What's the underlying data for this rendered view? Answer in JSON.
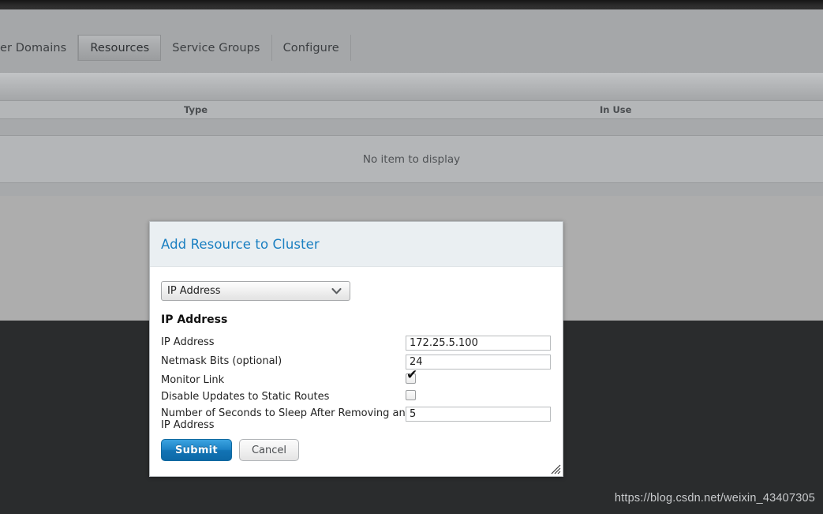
{
  "nav": {
    "items": [
      {
        "label": "er Domains",
        "active": false
      },
      {
        "label": "Resources",
        "active": true
      },
      {
        "label": "Service Groups",
        "active": false
      },
      {
        "label": "Configure",
        "active": false
      }
    ]
  },
  "table": {
    "columns": [
      {
        "label": "Type"
      },
      {
        "label": "In Use"
      }
    ],
    "empty_message": "No item to display",
    "rows": []
  },
  "dialog": {
    "title": "Add Resource to Cluster",
    "resource_type": {
      "selected": "IP Address",
      "options": [
        "IP Address"
      ],
      "chevron_icon": "chevron-down-icon"
    },
    "section_heading": "IP Address",
    "fields": [
      {
        "label": "IP Address",
        "type": "text",
        "value": "172.25.5.100"
      },
      {
        "label": "Netmask Bits (optional)",
        "type": "text",
        "value": "24"
      },
      {
        "label": "Monitor Link",
        "type": "checkbox",
        "checked": true,
        "check_glyph": "✔"
      },
      {
        "label": "Disable Updates to Static Routes",
        "type": "checkbox",
        "checked": false
      },
      {
        "label": "Number of Seconds to Sleep After Removing an IP Address",
        "type": "text",
        "value": "5"
      }
    ],
    "buttons": {
      "submit_label": "Submit",
      "cancel_label": "Cancel"
    },
    "resize_grip_icon": "resize-grip-icon"
  },
  "watermark": "https://blog.csdn.net/weixin_43407305",
  "colors": {
    "accent_blue": "#1a7fc1",
    "submit_blue": "#1273b4",
    "page_grey": "#adadad",
    "dark_area": "#2a2c2d",
    "dialog_header": "#eaeff2"
  }
}
